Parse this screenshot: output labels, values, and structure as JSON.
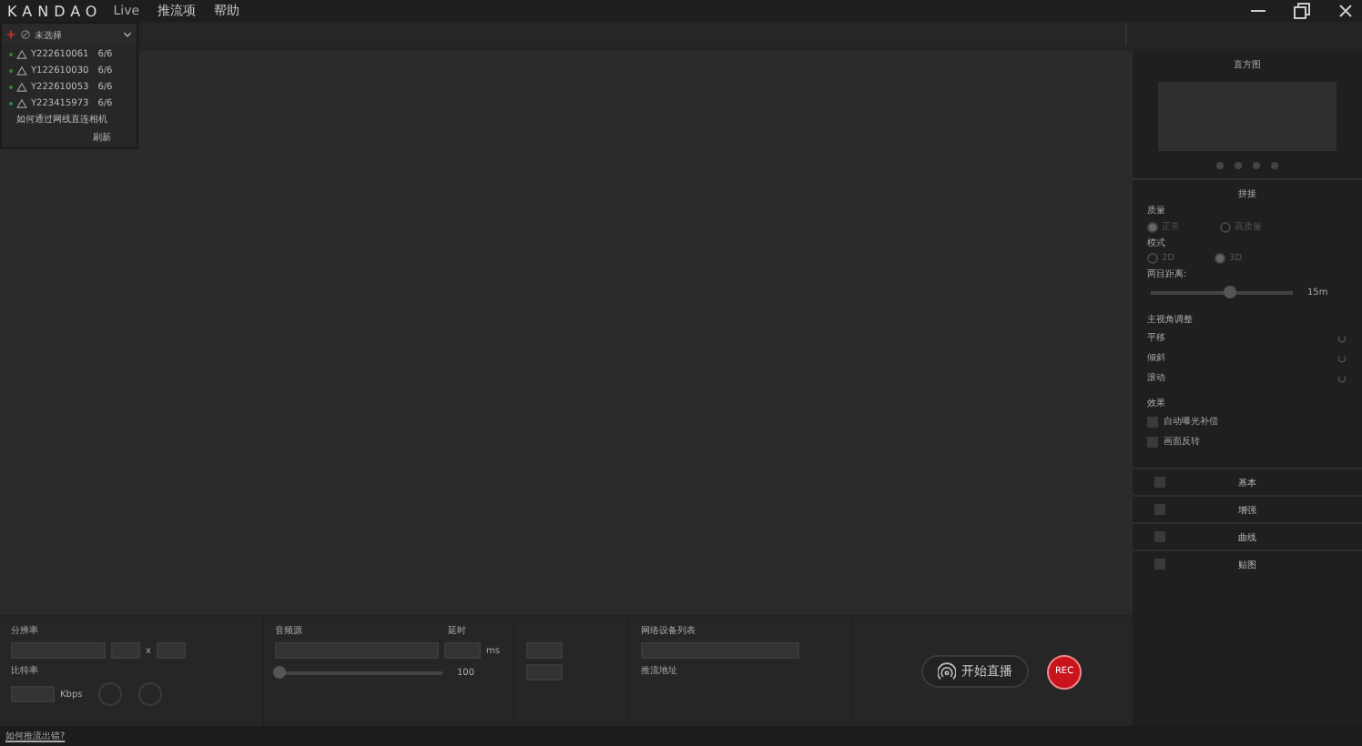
{
  "app": {
    "logo": "KANDAO",
    "product": "Live"
  },
  "menu": [
    {
      "label": "推流项"
    },
    {
      "label": "帮助"
    }
  ],
  "source_select": {
    "value": "未选择",
    "devices": [
      {
        "name": "Y222610061",
        "count": "6/6"
      },
      {
        "name": "Y122610030",
        "count": "6/6"
      },
      {
        "name": "Y222610053",
        "count": "6/6"
      },
      {
        "name": "Y223415973",
        "count": "6/6"
      }
    ],
    "help_link": "如何通过网线直连相机",
    "refresh": "刷新"
  },
  "side_panel": {
    "histogram_title": "直方图",
    "stitch_title": "拼接",
    "quality": {
      "label": "质量",
      "options": [
        {
          "label": "正常",
          "selected": true
        },
        {
          "label": "高质量",
          "selected": false
        }
      ]
    },
    "mode": {
      "label": "模式",
      "options": [
        {
          "label": "2D",
          "selected": false
        },
        {
          "label": "3D",
          "selected": true
        }
      ]
    },
    "distance": {
      "label": "两目距离:",
      "level": 0.55,
      "reading": "15m"
    },
    "view": {
      "label": "主视角调整",
      "items": [
        {
          "label": "平移"
        },
        {
          "label": "倾斜"
        },
        {
          "label": "滚动"
        }
      ]
    },
    "effects": {
      "label": "效果",
      "items": [
        {
          "label": "自动曝光补偿",
          "checked": false
        },
        {
          "label": "画面反转",
          "checked": false
        }
      ]
    },
    "sections": [
      {
        "label": "基本",
        "checked": false
      },
      {
        "label": "增强",
        "checked": false
      },
      {
        "label": "曲线",
        "checked": false
      },
      {
        "label": "贴图",
        "checked": false
      }
    ]
  },
  "bottom": {
    "resolution_label": "分辨率",
    "times": "x",
    "bitrate_label": "比特率",
    "bitrate_unit": "Kbps",
    "audio_label": "音频源",
    "delay_label": "延时",
    "delay_unit": "ms",
    "volume": {
      "level": 0,
      "reading": "100"
    },
    "network_label": "网络设备列表",
    "push_label": "推流地址",
    "live_button": "开始直播",
    "rec_button": "REC"
  },
  "status_link": "如何推流出错?"
}
